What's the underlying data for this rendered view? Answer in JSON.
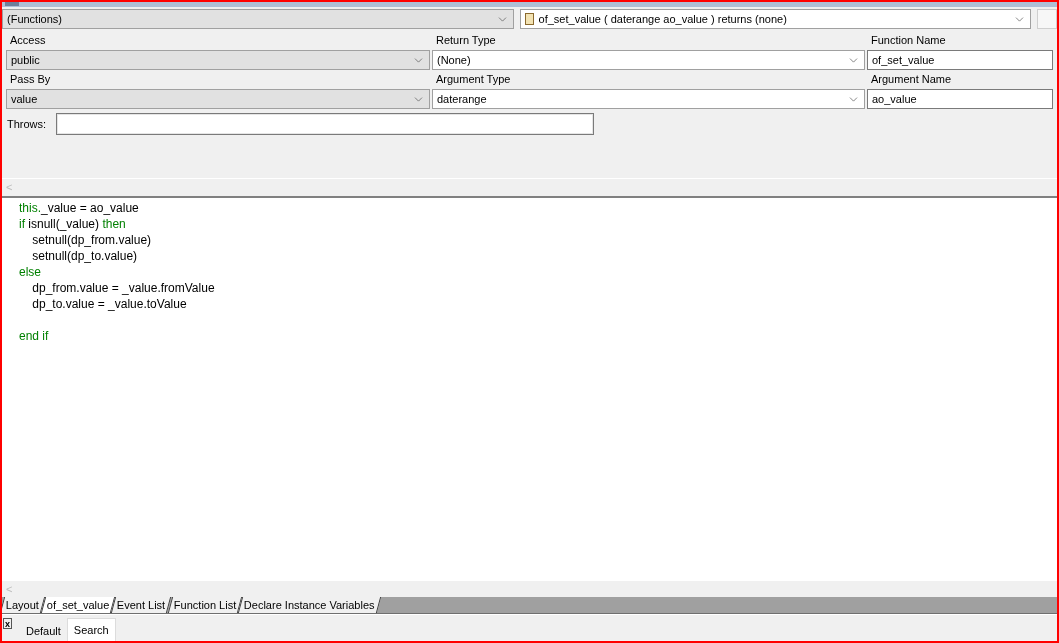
{
  "selectors": [
    {
      "value": "(Functions)",
      "icon": false
    },
    {
      "value": "of_set_value ( daterange ao_value ) returns (none)",
      "icon": true
    }
  ],
  "fields": [
    {
      "label": "Access",
      "value": "public",
      "kind": "dropdown",
      "disabled": true
    },
    {
      "label": "Return Type",
      "value": "(None)",
      "kind": "dropdown",
      "disabled": false
    },
    {
      "label": "Function Name",
      "value": "of_set_value",
      "kind": "text",
      "disabled": false
    },
    {
      "label": "Pass By",
      "value": "value",
      "kind": "dropdown",
      "disabled": true
    },
    {
      "label": "Argument Type",
      "value": "daterange",
      "kind": "dropdown",
      "disabled": false
    },
    {
      "label": "Argument Name",
      "value": "ao_value",
      "kind": "text",
      "disabled": false
    }
  ],
  "throws": {
    "label": "Throws:"
  },
  "scroll_left": "<",
  "code_blocks": [
    [
      [
        {
          "text": "this.",
          "kind": "keyword"
        },
        {
          "text": "_value = ao_value",
          "kind": "plain"
        }
      ],
      [
        {
          "text": "if",
          "kind": "keyword"
        },
        {
          "text": " isnull(_value) ",
          "kind": "plain"
        },
        {
          "text": "then",
          "kind": "keyword"
        }
      ],
      [
        {
          "text": "    setnull(dp_from.value)",
          "kind": "plain"
        }
      ],
      [
        {
          "text": "    setnull(dp_to.value)",
          "kind": "plain"
        }
      ],
      [
        {
          "text": "else",
          "kind": "keyword"
        }
      ],
      [
        {
          "text": "    dp_from.value = _value.fromValue",
          "kind": "plain"
        }
      ],
      [
        {
          "text": "    dp_to.value = _value.toValue",
          "kind": "plain"
        }
      ]
    ],
    [
      [
        {
          "text": "end if",
          "kind": "keyword"
        }
      ]
    ]
  ],
  "editor_scroll_left": "<",
  "tabs": [
    {
      "label": "Layout",
      "selected": false
    },
    {
      "label": "of_set_value",
      "selected": true
    },
    {
      "label": "Event List",
      "selected": false
    },
    {
      "label": "Function List",
      "selected": false
    },
    {
      "label": "Declare Instance Variables",
      "selected": false
    }
  ],
  "bottom": {
    "close": "x",
    "tabs": [
      {
        "label": "Default",
        "selected": false
      },
      {
        "label": "Search",
        "selected": true
      }
    ]
  }
}
